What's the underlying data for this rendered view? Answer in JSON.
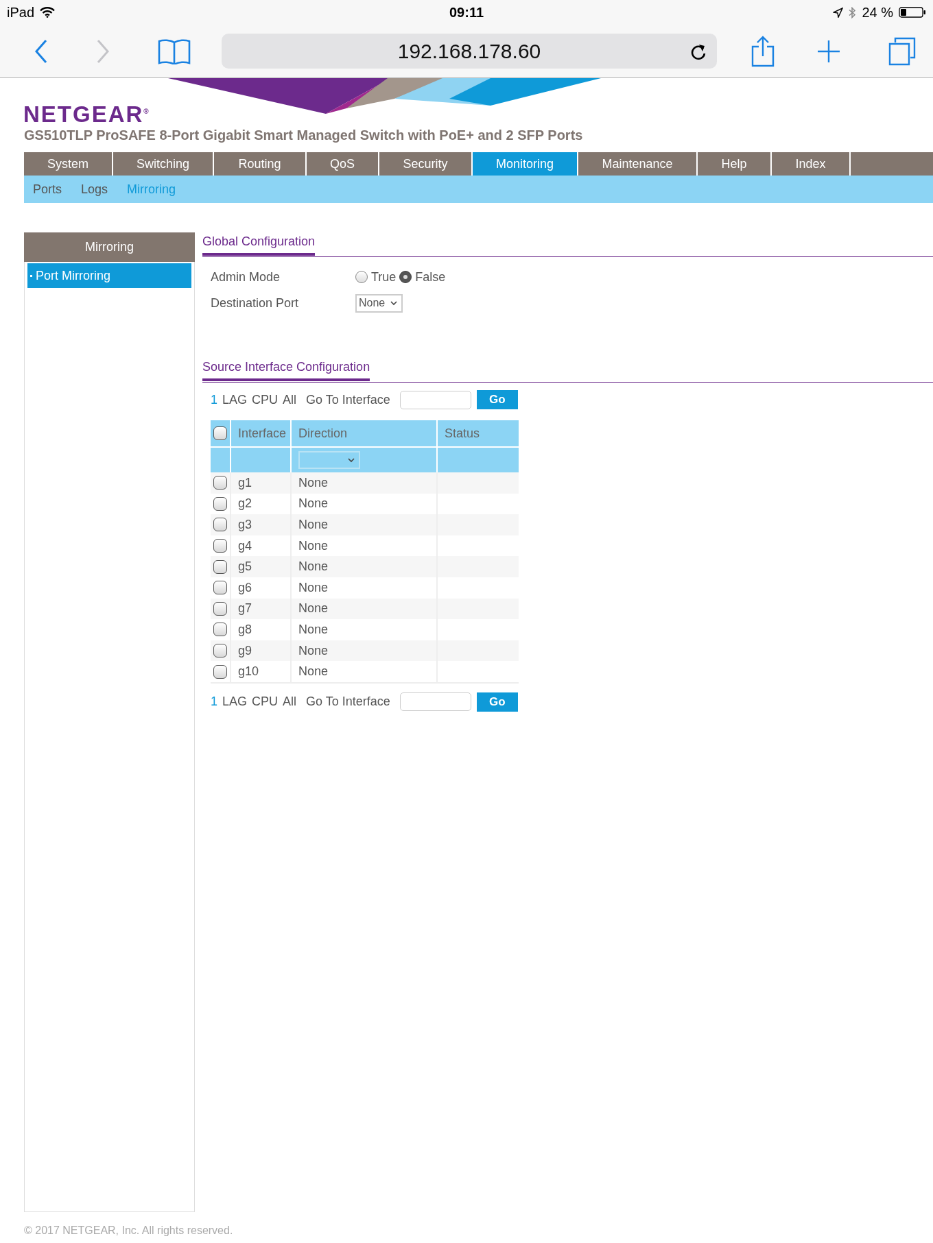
{
  "status_bar": {
    "device": "iPad",
    "time": "09:11",
    "battery": "24 %"
  },
  "browser": {
    "url": "192.168.178.60",
    "forward_disabled": true
  },
  "brand": {
    "logo": "NETGEAR",
    "mark": "®",
    "product": "GS510TLP ProSAFE 8-Port Gigabit Smart Managed Switch with PoE+ and 2 SFP Ports"
  },
  "tabs": [
    {
      "label": "System",
      "selected": false
    },
    {
      "label": "Switching",
      "selected": false
    },
    {
      "label": "Routing",
      "selected": false
    },
    {
      "label": "QoS",
      "selected": false
    },
    {
      "label": "Security",
      "selected": false
    },
    {
      "label": "Monitoring",
      "selected": true
    },
    {
      "label": "Maintenance",
      "selected": false
    },
    {
      "label": "Help",
      "selected": false
    },
    {
      "label": "Index",
      "selected": false
    }
  ],
  "subtabs": [
    {
      "label": "Ports",
      "selected": false
    },
    {
      "label": "Logs",
      "selected": false
    },
    {
      "label": "Mirroring",
      "selected": true
    }
  ],
  "sidebar": {
    "title": "Mirroring",
    "items": [
      {
        "label": "Port Mirroring",
        "selected": true
      }
    ]
  },
  "global_configuration": {
    "title": "Global Configuration",
    "admin_mode": {
      "label": "Admin Mode",
      "options": [
        {
          "label": "True",
          "selected": false
        },
        {
          "label": "False",
          "selected": true
        }
      ]
    },
    "destination_port": {
      "label": "Destination Port",
      "value": "None"
    }
  },
  "source_interface_configuration": {
    "title": "Source Interface Configuration",
    "interface_links": [
      {
        "label": "1",
        "selected": true
      },
      {
        "label": "LAG",
        "selected": false
      },
      {
        "label": "CPU",
        "selected": false
      },
      {
        "label": "All",
        "selected": false
      }
    ],
    "go_to_label": "Go To Interface",
    "go_button": "Go",
    "table": {
      "columns": [
        "Interface",
        "Direction",
        "Status"
      ],
      "select_all_checked": false,
      "rows": [
        {
          "checked": false,
          "interface": "g1",
          "direction": "None"
        },
        {
          "checked": false,
          "interface": "g2",
          "direction": "None"
        },
        {
          "checked": false,
          "interface": "g3",
          "direction": "None"
        },
        {
          "checked": false,
          "interface": "g4",
          "direction": "None"
        },
        {
          "checked": false,
          "interface": "g5",
          "direction": "None"
        },
        {
          "checked": false,
          "interface": "g6",
          "direction": "None"
        },
        {
          "checked": false,
          "interface": "g7",
          "direction": "None"
        },
        {
          "checked": false,
          "interface": "g8",
          "direction": "None"
        },
        {
          "checked": false,
          "interface": "g9",
          "direction": "None"
        },
        {
          "checked": false,
          "interface": "g10",
          "direction": "None"
        }
      ]
    },
    "bottom_interface_links": [
      {
        "label": "1",
        "selected": true
      },
      {
        "label": "LAG",
        "selected": false
      },
      {
        "label": "CPU",
        "selected": false
      },
      {
        "label": "All",
        "selected": false
      }
    ],
    "bottom_go_to_label": "Go To Interface",
    "bottom_go_button": "Go"
  },
  "footer": "© 2017 NETGEAR, Inc. All rights reserved."
}
